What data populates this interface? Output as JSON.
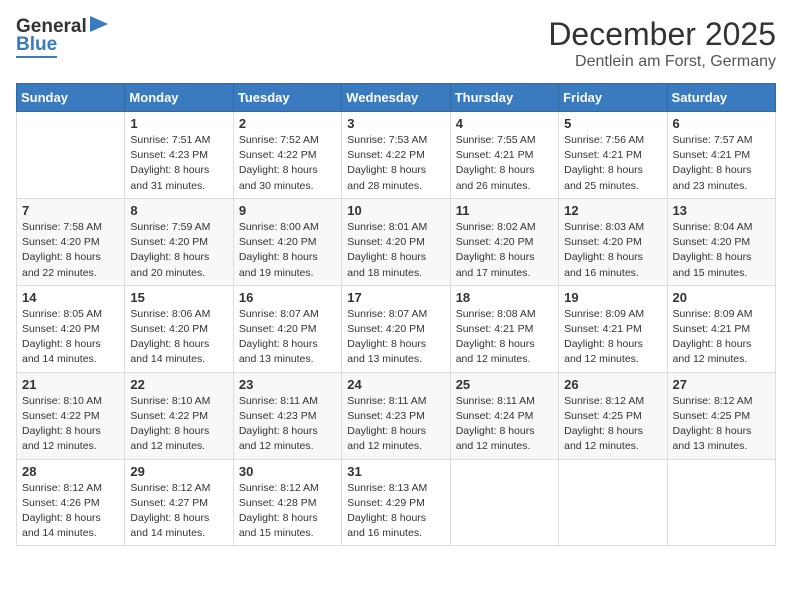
{
  "header": {
    "logo_general": "General",
    "logo_blue": "Blue",
    "month_year": "December 2025",
    "location": "Dentlein am Forst, Germany"
  },
  "days_of_week": [
    "Sunday",
    "Monday",
    "Tuesday",
    "Wednesday",
    "Thursday",
    "Friday",
    "Saturday"
  ],
  "weeks": [
    [
      {
        "day": "",
        "sunrise": "",
        "sunset": "",
        "daylight": ""
      },
      {
        "day": "1",
        "sunrise": "Sunrise: 7:51 AM",
        "sunset": "Sunset: 4:23 PM",
        "daylight": "Daylight: 8 hours and 31 minutes."
      },
      {
        "day": "2",
        "sunrise": "Sunrise: 7:52 AM",
        "sunset": "Sunset: 4:22 PM",
        "daylight": "Daylight: 8 hours and 30 minutes."
      },
      {
        "day": "3",
        "sunrise": "Sunrise: 7:53 AM",
        "sunset": "Sunset: 4:22 PM",
        "daylight": "Daylight: 8 hours and 28 minutes."
      },
      {
        "day": "4",
        "sunrise": "Sunrise: 7:55 AM",
        "sunset": "Sunset: 4:21 PM",
        "daylight": "Daylight: 8 hours and 26 minutes."
      },
      {
        "day": "5",
        "sunrise": "Sunrise: 7:56 AM",
        "sunset": "Sunset: 4:21 PM",
        "daylight": "Daylight: 8 hours and 25 minutes."
      },
      {
        "day": "6",
        "sunrise": "Sunrise: 7:57 AM",
        "sunset": "Sunset: 4:21 PM",
        "daylight": "Daylight: 8 hours and 23 minutes."
      }
    ],
    [
      {
        "day": "7",
        "sunrise": "Sunrise: 7:58 AM",
        "sunset": "Sunset: 4:20 PM",
        "daylight": "Daylight: 8 hours and 22 minutes."
      },
      {
        "day": "8",
        "sunrise": "Sunrise: 7:59 AM",
        "sunset": "Sunset: 4:20 PM",
        "daylight": "Daylight: 8 hours and 20 minutes."
      },
      {
        "day": "9",
        "sunrise": "Sunrise: 8:00 AM",
        "sunset": "Sunset: 4:20 PM",
        "daylight": "Daylight: 8 hours and 19 minutes."
      },
      {
        "day": "10",
        "sunrise": "Sunrise: 8:01 AM",
        "sunset": "Sunset: 4:20 PM",
        "daylight": "Daylight: 8 hours and 18 minutes."
      },
      {
        "day": "11",
        "sunrise": "Sunrise: 8:02 AM",
        "sunset": "Sunset: 4:20 PM",
        "daylight": "Daylight: 8 hours and 17 minutes."
      },
      {
        "day": "12",
        "sunrise": "Sunrise: 8:03 AM",
        "sunset": "Sunset: 4:20 PM",
        "daylight": "Daylight: 8 hours and 16 minutes."
      },
      {
        "day": "13",
        "sunrise": "Sunrise: 8:04 AM",
        "sunset": "Sunset: 4:20 PM",
        "daylight": "Daylight: 8 hours and 15 minutes."
      }
    ],
    [
      {
        "day": "14",
        "sunrise": "Sunrise: 8:05 AM",
        "sunset": "Sunset: 4:20 PM",
        "daylight": "Daylight: 8 hours and 14 minutes."
      },
      {
        "day": "15",
        "sunrise": "Sunrise: 8:06 AM",
        "sunset": "Sunset: 4:20 PM",
        "daylight": "Daylight: 8 hours and 14 minutes."
      },
      {
        "day": "16",
        "sunrise": "Sunrise: 8:07 AM",
        "sunset": "Sunset: 4:20 PM",
        "daylight": "Daylight: 8 hours and 13 minutes."
      },
      {
        "day": "17",
        "sunrise": "Sunrise: 8:07 AM",
        "sunset": "Sunset: 4:20 PM",
        "daylight": "Daylight: 8 hours and 13 minutes."
      },
      {
        "day": "18",
        "sunrise": "Sunrise: 8:08 AM",
        "sunset": "Sunset: 4:21 PM",
        "daylight": "Daylight: 8 hours and 12 minutes."
      },
      {
        "day": "19",
        "sunrise": "Sunrise: 8:09 AM",
        "sunset": "Sunset: 4:21 PM",
        "daylight": "Daylight: 8 hours and 12 minutes."
      },
      {
        "day": "20",
        "sunrise": "Sunrise: 8:09 AM",
        "sunset": "Sunset: 4:21 PM",
        "daylight": "Daylight: 8 hours and 12 minutes."
      }
    ],
    [
      {
        "day": "21",
        "sunrise": "Sunrise: 8:10 AM",
        "sunset": "Sunset: 4:22 PM",
        "daylight": "Daylight: 8 hours and 12 minutes."
      },
      {
        "day": "22",
        "sunrise": "Sunrise: 8:10 AM",
        "sunset": "Sunset: 4:22 PM",
        "daylight": "Daylight: 8 hours and 12 minutes."
      },
      {
        "day": "23",
        "sunrise": "Sunrise: 8:11 AM",
        "sunset": "Sunset: 4:23 PM",
        "daylight": "Daylight: 8 hours and 12 minutes."
      },
      {
        "day": "24",
        "sunrise": "Sunrise: 8:11 AM",
        "sunset": "Sunset: 4:23 PM",
        "daylight": "Daylight: 8 hours and 12 minutes."
      },
      {
        "day": "25",
        "sunrise": "Sunrise: 8:11 AM",
        "sunset": "Sunset: 4:24 PM",
        "daylight": "Daylight: 8 hours and 12 minutes."
      },
      {
        "day": "26",
        "sunrise": "Sunrise: 8:12 AM",
        "sunset": "Sunset: 4:25 PM",
        "daylight": "Daylight: 8 hours and 12 minutes."
      },
      {
        "day": "27",
        "sunrise": "Sunrise: 8:12 AM",
        "sunset": "Sunset: 4:25 PM",
        "daylight": "Daylight: 8 hours and 13 minutes."
      }
    ],
    [
      {
        "day": "28",
        "sunrise": "Sunrise: 8:12 AM",
        "sunset": "Sunset: 4:26 PM",
        "daylight": "Daylight: 8 hours and 14 minutes."
      },
      {
        "day": "29",
        "sunrise": "Sunrise: 8:12 AM",
        "sunset": "Sunset: 4:27 PM",
        "daylight": "Daylight: 8 hours and 14 minutes."
      },
      {
        "day": "30",
        "sunrise": "Sunrise: 8:12 AM",
        "sunset": "Sunset: 4:28 PM",
        "daylight": "Daylight: 8 hours and 15 minutes."
      },
      {
        "day": "31",
        "sunrise": "Sunrise: 8:13 AM",
        "sunset": "Sunset: 4:29 PM",
        "daylight": "Daylight: 8 hours and 16 minutes."
      },
      {
        "day": "",
        "sunrise": "",
        "sunset": "",
        "daylight": ""
      },
      {
        "day": "",
        "sunrise": "",
        "sunset": "",
        "daylight": ""
      },
      {
        "day": "",
        "sunrise": "",
        "sunset": "",
        "daylight": ""
      }
    ]
  ]
}
